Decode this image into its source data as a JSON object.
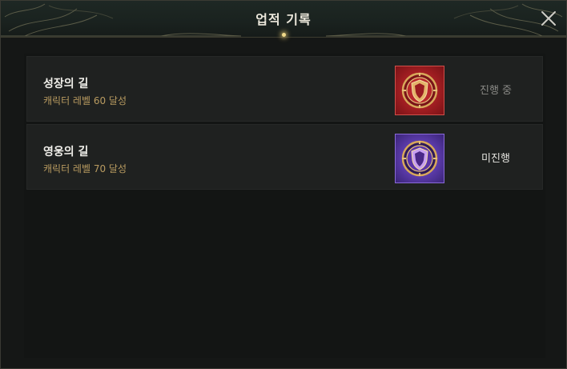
{
  "window": {
    "title": "업적 기록"
  },
  "achievements": [
    {
      "name": "성장의 길",
      "description": "캐릭터 레벨 60 달성",
      "status": "진행 중",
      "emblem_color": "#a21e22"
    },
    {
      "name": "영웅의 길",
      "description": "캐릭터 레벨 70 달성",
      "status": "미진행",
      "emblem_color": "#5a3aa8"
    }
  ],
  "colors": {
    "accent_gold": "#b99b60",
    "title_text": "#ece8dc",
    "panel_bg": "#151716"
  },
  "icons": {
    "close": "close-icon",
    "emblem_red": "shield-emblem-icon",
    "emblem_purple": "shield-emblem-icon"
  }
}
